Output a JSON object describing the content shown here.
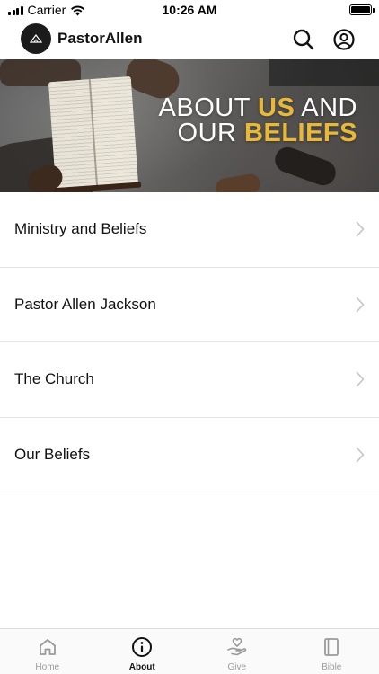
{
  "status_bar": {
    "carrier": "Carrier",
    "time": "10:26 AM"
  },
  "header": {
    "title": "PastorAllen"
  },
  "hero": {
    "line1_plain": "ABOUT",
    "line1_accent": "US",
    "line1_end": "AND",
    "line2_plain": "OUR",
    "line2_accent": "BELIEFS",
    "accent_color": "#e8b839"
  },
  "menu": {
    "items": [
      {
        "label": "Ministry and Beliefs"
      },
      {
        "label": "Pastor Allen Jackson"
      },
      {
        "label": "The Church"
      },
      {
        "label": "Our Beliefs"
      }
    ]
  },
  "tab_bar": {
    "tabs": [
      {
        "label": "Home",
        "icon": "home-icon",
        "active": false
      },
      {
        "label": "About",
        "icon": "info-icon",
        "active": true
      },
      {
        "label": "Give",
        "icon": "give-icon",
        "active": false
      },
      {
        "label": "Bible",
        "icon": "bible-icon",
        "active": false
      }
    ]
  },
  "colors": {
    "active_tab": "#111111",
    "inactive_tab": "#9a9a9a"
  }
}
